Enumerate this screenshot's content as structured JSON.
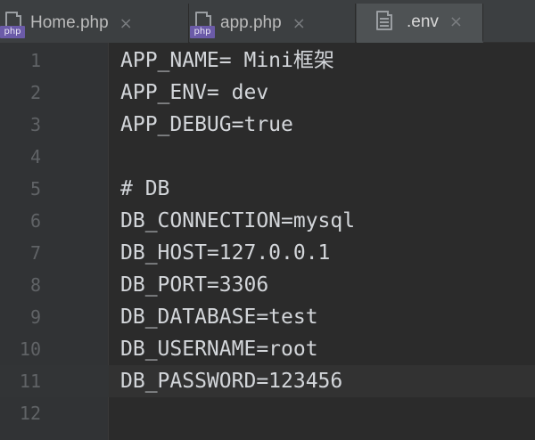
{
  "tabs": [
    {
      "label": "Home.php",
      "icon": "php-file-icon",
      "badge": "php",
      "active": false
    },
    {
      "label": "app.php",
      "icon": "php-file-icon",
      "badge": "php",
      "active": false
    },
    {
      "label": ".env",
      "icon": "text-file-icon",
      "badge": "",
      "active": true
    }
  ],
  "close_glyph": "×",
  "editor": {
    "current_line": 11,
    "lines": [
      {
        "number": "1",
        "text": "APP_NAME= Mini框架"
      },
      {
        "number": "2",
        "text": "APP_ENV= dev"
      },
      {
        "number": "3",
        "text": "APP_DEBUG=true"
      },
      {
        "number": "4",
        "text": ""
      },
      {
        "number": "5",
        "text": "# DB"
      },
      {
        "number": "6",
        "text": "DB_CONNECTION=mysql"
      },
      {
        "number": "7",
        "text": "DB_HOST=127.0.0.1"
      },
      {
        "number": "8",
        "text": "DB_PORT=3306"
      },
      {
        "number": "9",
        "text": "DB_DATABASE=test"
      },
      {
        "number": "10",
        "text": "DB_USERNAME=root"
      },
      {
        "number": "11",
        "text": "DB_PASSWORD=123456"
      },
      {
        "number": "12",
        "text": ""
      }
    ]
  },
  "colors": {
    "background": "#2b2b2b",
    "gutter": "#313335",
    "tabbar": "#3c3f41",
    "active_tab": "#4e5254",
    "text": "#d3d6da",
    "line_number": "#606366",
    "php_badge": "#6b5ba8"
  }
}
